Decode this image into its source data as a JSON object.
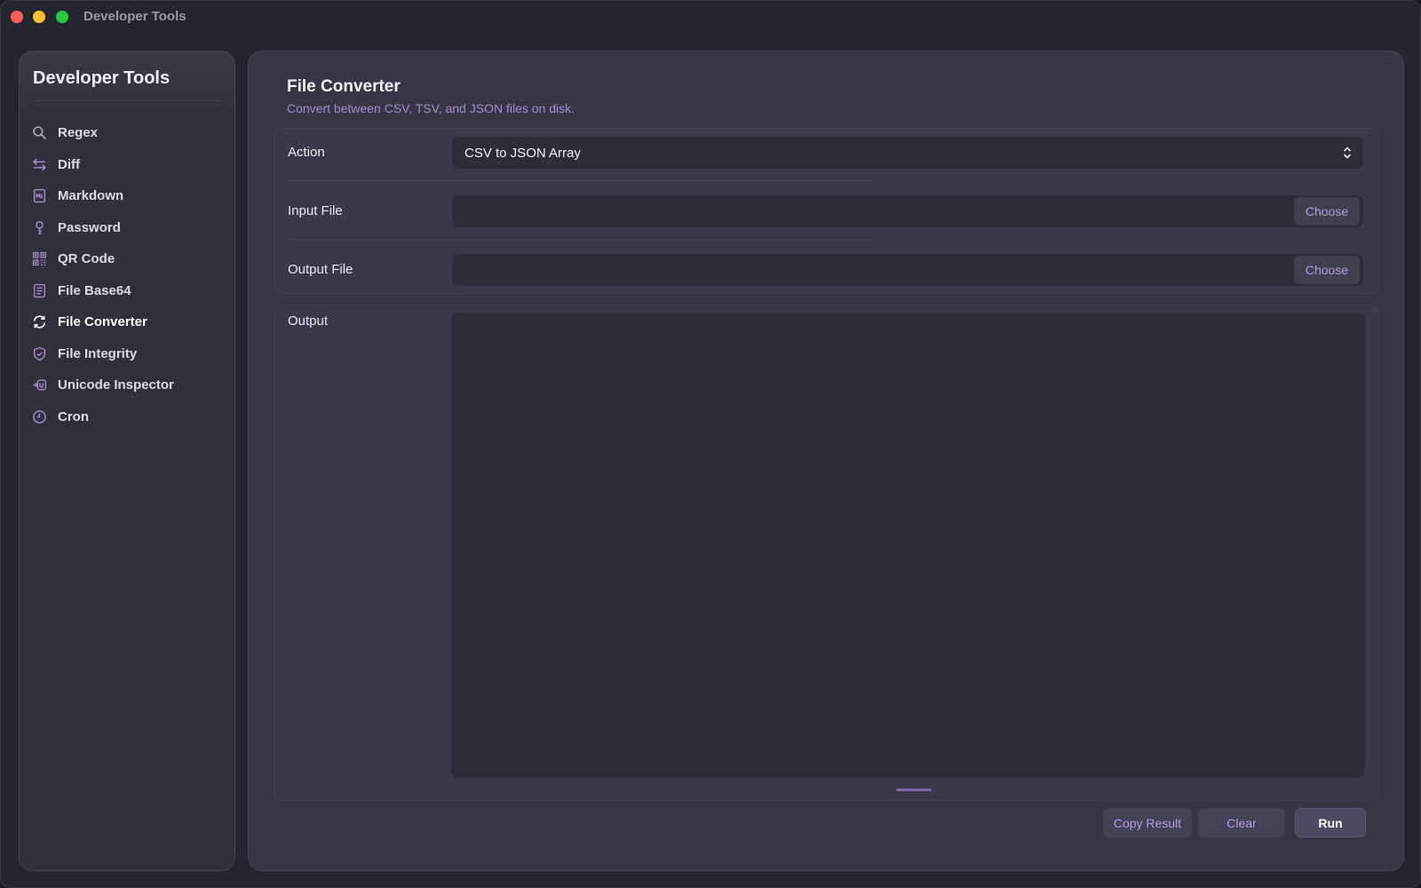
{
  "window": {
    "title": "Developer Tools"
  },
  "sidebar": {
    "title": "Developer Tools",
    "items": [
      {
        "label": "Regex",
        "icon": "search-icon"
      },
      {
        "label": "Diff",
        "icon": "arrows-swap-icon"
      },
      {
        "label": "Markdown",
        "icon": "markdown-doc-icon"
      },
      {
        "label": "Password",
        "icon": "key-icon"
      },
      {
        "label": "QR Code",
        "icon": "qr-code-icon"
      },
      {
        "label": "File Base64",
        "icon": "document-icon"
      },
      {
        "label": "File Converter",
        "icon": "refresh-icon",
        "active": true
      },
      {
        "label": "File Integrity",
        "icon": "shield-check-icon"
      },
      {
        "label": "Unicode Inspector",
        "icon": "unicode-icon"
      },
      {
        "label": "Cron",
        "icon": "clock-icon"
      }
    ]
  },
  "main": {
    "title": "File Converter",
    "subtitle": "Convert between CSV, TSV, and JSON files on disk.",
    "action_label": "Action",
    "action_value": "CSV to JSON Array",
    "input_file_label": "Input File",
    "input_file_value": "",
    "output_file_label": "Output File",
    "output_file_value": "",
    "choose_label": "Choose",
    "output_label": "Output",
    "output_value": "",
    "buttons": {
      "copy_result": "Copy Result",
      "clear": "Clear",
      "run": "Run"
    }
  },
  "colors": {
    "accent": "#a98cd6",
    "button_text": "#b79be4",
    "background": "#25252f"
  }
}
